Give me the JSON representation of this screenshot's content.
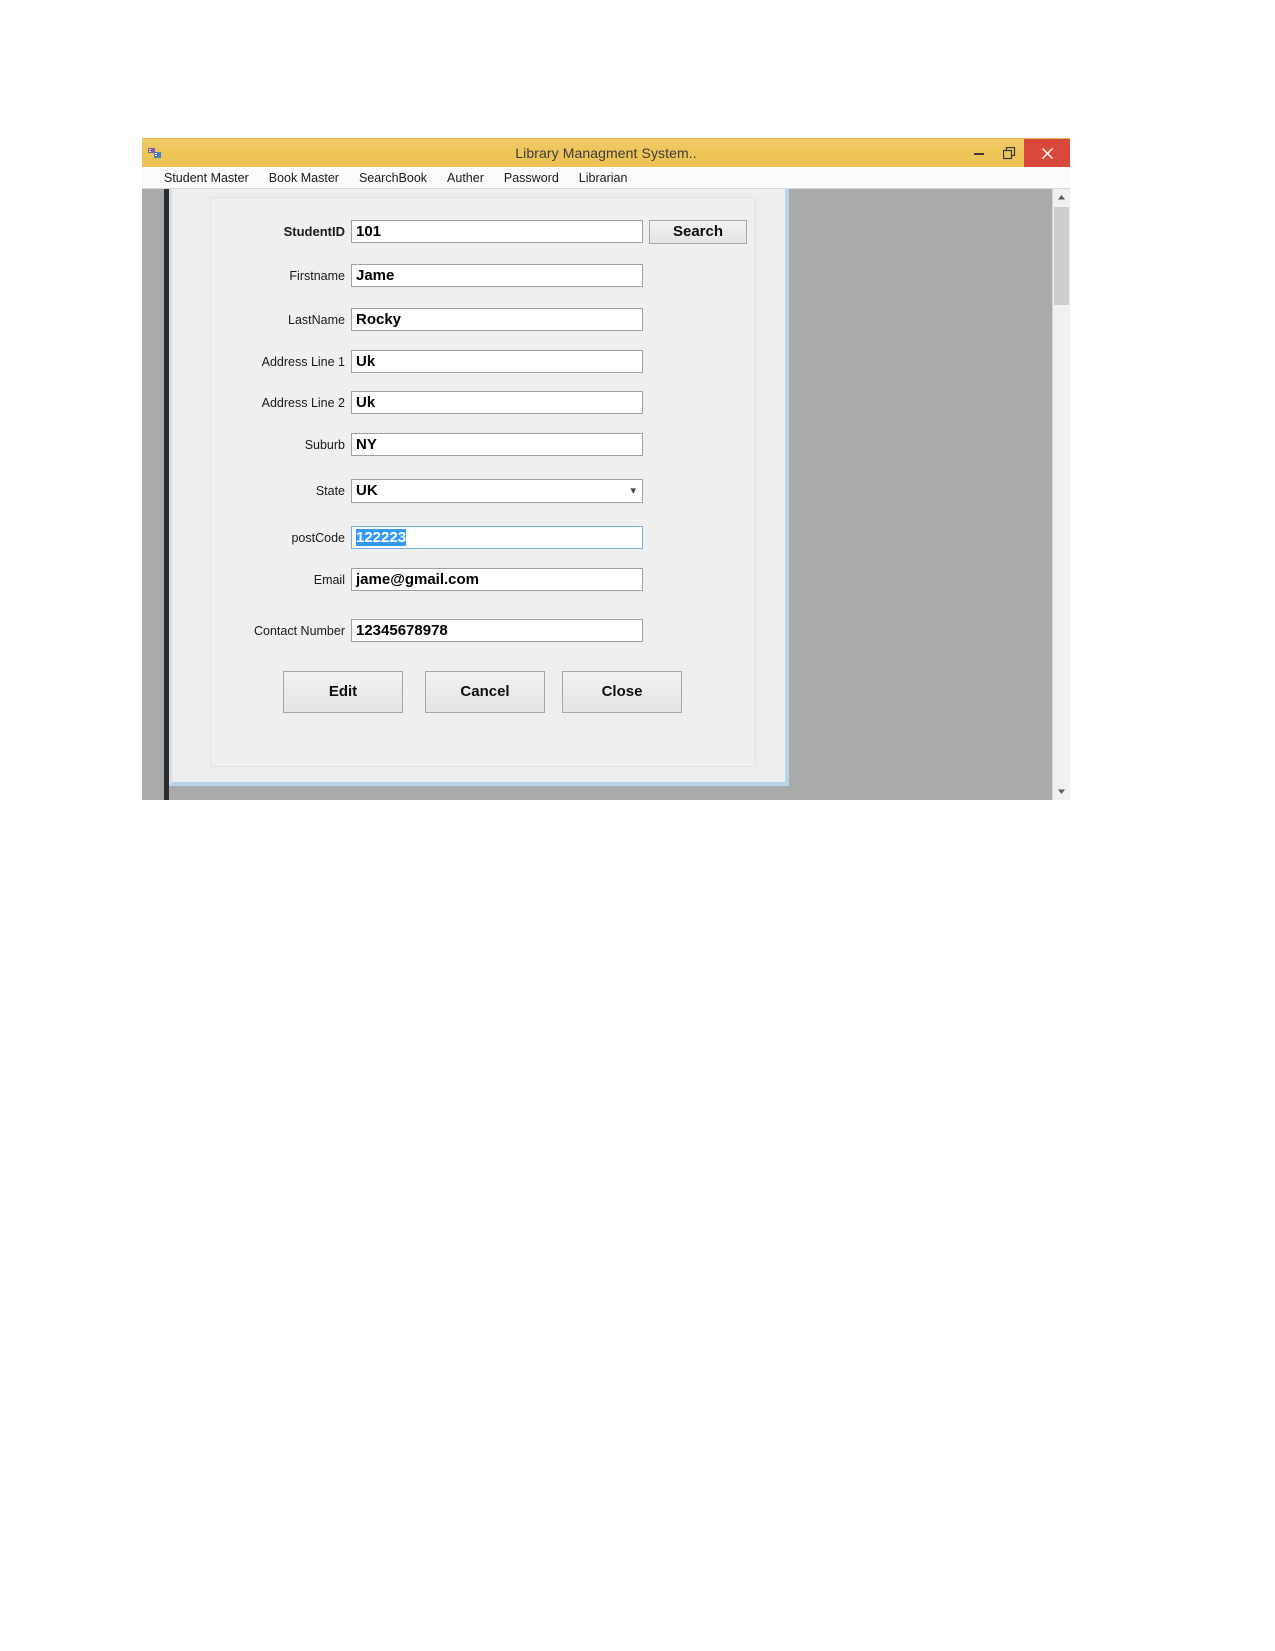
{
  "window": {
    "title": "Library Managment System..",
    "icon": "app-icon",
    "buttons": {
      "minimize": "minimize-icon",
      "maximize": "restore-icon",
      "close": "close-icon"
    }
  },
  "menubar": {
    "items": [
      {
        "label": "Student Master"
      },
      {
        "label": "Book Master"
      },
      {
        "label": "SearchBook"
      },
      {
        "label": "Auther"
      },
      {
        "label": "Password"
      },
      {
        "label": "Librarian"
      }
    ]
  },
  "form": {
    "fields": [
      {
        "label": "StudentID",
        "value": "101",
        "type": "text"
      },
      {
        "label": "Firstname",
        "value": "Jame",
        "type": "text"
      },
      {
        "label": "LastName",
        "value": "Rocky",
        "type": "text"
      },
      {
        "label": "Address Line 1",
        "value": "Uk",
        "type": "text"
      },
      {
        "label": "Address Line 2",
        "value": "Uk",
        "type": "text"
      },
      {
        "label": "Suburb",
        "value": "NY",
        "type": "text"
      },
      {
        "label": "State",
        "value": "UK",
        "type": "combo"
      },
      {
        "label": "postCode",
        "value": "122223",
        "type": "text",
        "selected": true,
        "focused": true
      },
      {
        "label": "Email",
        "value": "jame@gmail.com",
        "type": "text"
      },
      {
        "label": "Contact Number",
        "value": "12345678978",
        "type": "text"
      }
    ],
    "search_button": "Search",
    "actions": [
      {
        "label": "Edit"
      },
      {
        "label": "Cancel"
      },
      {
        "label": "Close"
      }
    ]
  },
  "colors": {
    "titlebar": "#efc559",
    "close_button": "#d9483b",
    "selection": "#3399ff",
    "mdi_backdrop": "#aaaaaa",
    "child_border": "#b8d4e8"
  }
}
